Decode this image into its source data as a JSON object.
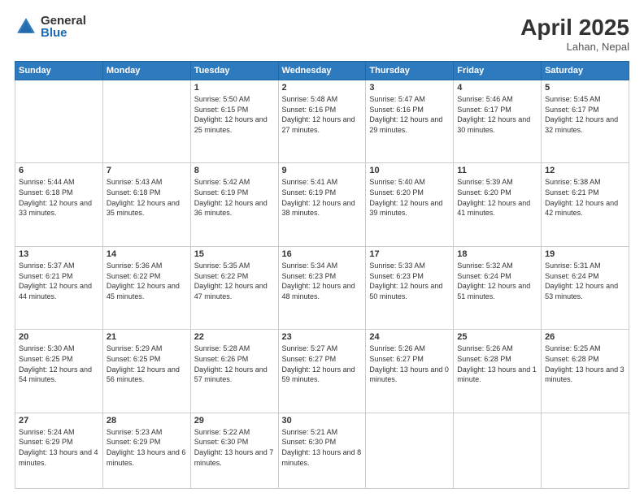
{
  "logo": {
    "general": "General",
    "blue": "Blue"
  },
  "title": "April 2025",
  "location": "Lahan, Nepal",
  "days_header": [
    "Sunday",
    "Monday",
    "Tuesday",
    "Wednesday",
    "Thursday",
    "Friday",
    "Saturday"
  ],
  "weeks": [
    [
      {
        "num": "",
        "info": ""
      },
      {
        "num": "",
        "info": ""
      },
      {
        "num": "1",
        "info": "Sunrise: 5:50 AM\nSunset: 6:15 PM\nDaylight: 12 hours and 25 minutes."
      },
      {
        "num": "2",
        "info": "Sunrise: 5:48 AM\nSunset: 6:16 PM\nDaylight: 12 hours and 27 minutes."
      },
      {
        "num": "3",
        "info": "Sunrise: 5:47 AM\nSunset: 6:16 PM\nDaylight: 12 hours and 29 minutes."
      },
      {
        "num": "4",
        "info": "Sunrise: 5:46 AM\nSunset: 6:17 PM\nDaylight: 12 hours and 30 minutes."
      },
      {
        "num": "5",
        "info": "Sunrise: 5:45 AM\nSunset: 6:17 PM\nDaylight: 12 hours and 32 minutes."
      }
    ],
    [
      {
        "num": "6",
        "info": "Sunrise: 5:44 AM\nSunset: 6:18 PM\nDaylight: 12 hours and 33 minutes."
      },
      {
        "num": "7",
        "info": "Sunrise: 5:43 AM\nSunset: 6:18 PM\nDaylight: 12 hours and 35 minutes."
      },
      {
        "num": "8",
        "info": "Sunrise: 5:42 AM\nSunset: 6:19 PM\nDaylight: 12 hours and 36 minutes."
      },
      {
        "num": "9",
        "info": "Sunrise: 5:41 AM\nSunset: 6:19 PM\nDaylight: 12 hours and 38 minutes."
      },
      {
        "num": "10",
        "info": "Sunrise: 5:40 AM\nSunset: 6:20 PM\nDaylight: 12 hours and 39 minutes."
      },
      {
        "num": "11",
        "info": "Sunrise: 5:39 AM\nSunset: 6:20 PM\nDaylight: 12 hours and 41 minutes."
      },
      {
        "num": "12",
        "info": "Sunrise: 5:38 AM\nSunset: 6:21 PM\nDaylight: 12 hours and 42 minutes."
      }
    ],
    [
      {
        "num": "13",
        "info": "Sunrise: 5:37 AM\nSunset: 6:21 PM\nDaylight: 12 hours and 44 minutes."
      },
      {
        "num": "14",
        "info": "Sunrise: 5:36 AM\nSunset: 6:22 PM\nDaylight: 12 hours and 45 minutes."
      },
      {
        "num": "15",
        "info": "Sunrise: 5:35 AM\nSunset: 6:22 PM\nDaylight: 12 hours and 47 minutes."
      },
      {
        "num": "16",
        "info": "Sunrise: 5:34 AM\nSunset: 6:23 PM\nDaylight: 12 hours and 48 minutes."
      },
      {
        "num": "17",
        "info": "Sunrise: 5:33 AM\nSunset: 6:23 PM\nDaylight: 12 hours and 50 minutes."
      },
      {
        "num": "18",
        "info": "Sunrise: 5:32 AM\nSunset: 6:24 PM\nDaylight: 12 hours and 51 minutes."
      },
      {
        "num": "19",
        "info": "Sunrise: 5:31 AM\nSunset: 6:24 PM\nDaylight: 12 hours and 53 minutes."
      }
    ],
    [
      {
        "num": "20",
        "info": "Sunrise: 5:30 AM\nSunset: 6:25 PM\nDaylight: 12 hours and 54 minutes."
      },
      {
        "num": "21",
        "info": "Sunrise: 5:29 AM\nSunset: 6:25 PM\nDaylight: 12 hours and 56 minutes."
      },
      {
        "num": "22",
        "info": "Sunrise: 5:28 AM\nSunset: 6:26 PM\nDaylight: 12 hours and 57 minutes."
      },
      {
        "num": "23",
        "info": "Sunrise: 5:27 AM\nSunset: 6:27 PM\nDaylight: 12 hours and 59 minutes."
      },
      {
        "num": "24",
        "info": "Sunrise: 5:26 AM\nSunset: 6:27 PM\nDaylight: 13 hours and 0 minutes."
      },
      {
        "num": "25",
        "info": "Sunrise: 5:26 AM\nSunset: 6:28 PM\nDaylight: 13 hours and 1 minute."
      },
      {
        "num": "26",
        "info": "Sunrise: 5:25 AM\nSunset: 6:28 PM\nDaylight: 13 hours and 3 minutes."
      }
    ],
    [
      {
        "num": "27",
        "info": "Sunrise: 5:24 AM\nSunset: 6:29 PM\nDaylight: 13 hours and 4 minutes."
      },
      {
        "num": "28",
        "info": "Sunrise: 5:23 AM\nSunset: 6:29 PM\nDaylight: 13 hours and 6 minutes."
      },
      {
        "num": "29",
        "info": "Sunrise: 5:22 AM\nSunset: 6:30 PM\nDaylight: 13 hours and 7 minutes."
      },
      {
        "num": "30",
        "info": "Sunrise: 5:21 AM\nSunset: 6:30 PM\nDaylight: 13 hours and 8 minutes."
      },
      {
        "num": "",
        "info": ""
      },
      {
        "num": "",
        "info": ""
      },
      {
        "num": "",
        "info": ""
      }
    ]
  ]
}
